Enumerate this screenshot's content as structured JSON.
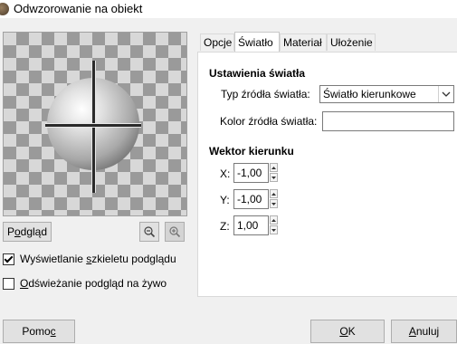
{
  "window": {
    "title": "Odwzorowanie na obiekt"
  },
  "preview": {
    "button": {
      "prefix": "P",
      "mnemonic": "o",
      "suffix": "dgląd"
    },
    "zoom_out_icon": "zoom-out-icon",
    "zoom_in_icon": "zoom-in-icon"
  },
  "options": {
    "wireframe": {
      "prefix": "Wyświetlanie ",
      "mnemonic": "s",
      "suffix": "zkieletu podglądu",
      "checked": true
    },
    "live": {
      "prefix": "",
      "mnemonic": "O",
      "suffix": "dświeżanie podgląd na żywo",
      "checked": false
    }
  },
  "tabs": [
    {
      "label": "Opcje",
      "active": false
    },
    {
      "label": "Światło",
      "active": true
    },
    {
      "label": "Materiał",
      "active": false
    },
    {
      "label": "Ułożenie",
      "active": false
    }
  ],
  "light": {
    "section_title": "Ustawienia światła",
    "source_type_label": "Typ źródła światła:",
    "source_type_value": "Światło kierunkowe",
    "color_label": "Kolor źródła światła:",
    "color_value": "#ffffff"
  },
  "direction": {
    "section_title": "Wektor kierunku",
    "x_label": "X:",
    "x_value": "-1,00",
    "y_label": "Y:",
    "y_value": "-1,00",
    "z_label": "Z:",
    "z_value": "1,00"
  },
  "buttons": {
    "help": {
      "prefix": "Pomo",
      "mnemonic": "c",
      "suffix": ""
    },
    "ok": {
      "prefix": "",
      "mnemonic": "O",
      "suffix": "K"
    },
    "cancel": {
      "prefix": "",
      "mnemonic": "A",
      "suffix": "nuluj"
    }
  }
}
